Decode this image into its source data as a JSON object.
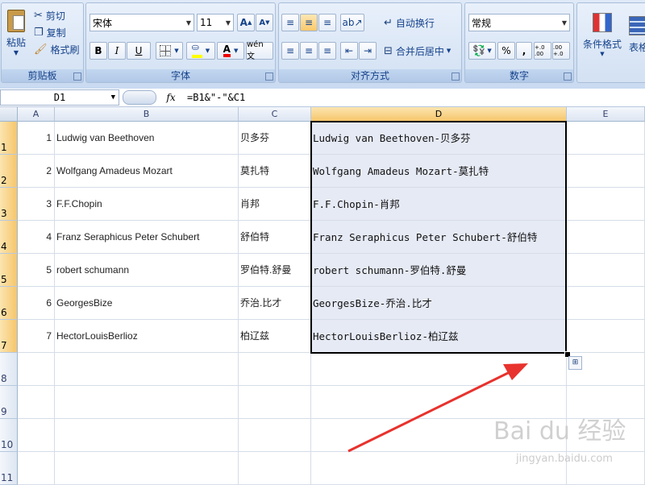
{
  "ribbon": {
    "clipboard": {
      "title": "剪贴板",
      "paste": "粘贴",
      "cut": "剪切",
      "copy": "复制",
      "format_painter": "格式刷"
    },
    "font": {
      "title": "字体",
      "font_name": "宋体",
      "font_size": "11",
      "bold": "B",
      "italic": "I",
      "underline": "U",
      "grow": "A",
      "shrink": "A",
      "font_color_glyph": "A",
      "phonetic": "wén 文"
    },
    "alignment": {
      "title": "对齐方式",
      "wrap_text": "自动换行",
      "merge_center": "合并后居中"
    },
    "number": {
      "title": "数字",
      "format": "常规",
      "percent": "%",
      "comma": ",",
      "inc_decimal": "+.0 .00",
      "dec_decimal": ".00 +.0"
    },
    "styles": {
      "conditional_format": "条件格式",
      "table_format": "表格格"
    }
  },
  "formula_bar": {
    "name_box": "D1",
    "fx": "fx",
    "formula": "=B1&\"-\"&C1"
  },
  "columns": [
    "A",
    "B",
    "C",
    "D",
    "E"
  ],
  "rows": [
    "1",
    "2",
    "3",
    "4",
    "5",
    "6",
    "7",
    "8",
    "9",
    "10",
    "11"
  ],
  "data_rows": [
    {
      "a": "1",
      "b": "Ludwig van Beethoven",
      "c": "贝多芬",
      "d": "Ludwig van Beethoven-贝多芬"
    },
    {
      "a": "2",
      "b": "Wolfgang Amadeus Mozart",
      "c": "莫扎特",
      "d": "Wolfgang Amadeus  Mozart-莫扎特"
    },
    {
      "a": "3",
      "b": "F.F.Chopin",
      "c": "肖邦",
      "d": "F.F.Chopin-肖邦"
    },
    {
      "a": "4",
      "b": "Franz Seraphicus Peter Schubert",
      "c": "舒伯特",
      "d": "Franz  Seraphicus  Peter  Schubert-舒伯特"
    },
    {
      "a": "5",
      "b": "robert schumann",
      "c": "罗伯特.舒曼",
      "d": "robert schumann-罗伯特.舒曼"
    },
    {
      "a": "6",
      "b": "GeorgesBize",
      "c": "乔治.比才",
      "d": "GeorgesBize-乔治.比才"
    },
    {
      "a": "7",
      "b": "HectorLouisBerlioz",
      "c": "柏辽兹",
      "d": "HectorLouisBerlioz-柏辽兹"
    }
  ],
  "colors": {
    "accent": "#15428b",
    "selection_header": "#f6c66b",
    "selection_fill": "#e6eaf5",
    "arrow": "#e8322d"
  },
  "watermark": {
    "brand": "Bai du 经验",
    "url": "jingyan.baidu.com"
  }
}
